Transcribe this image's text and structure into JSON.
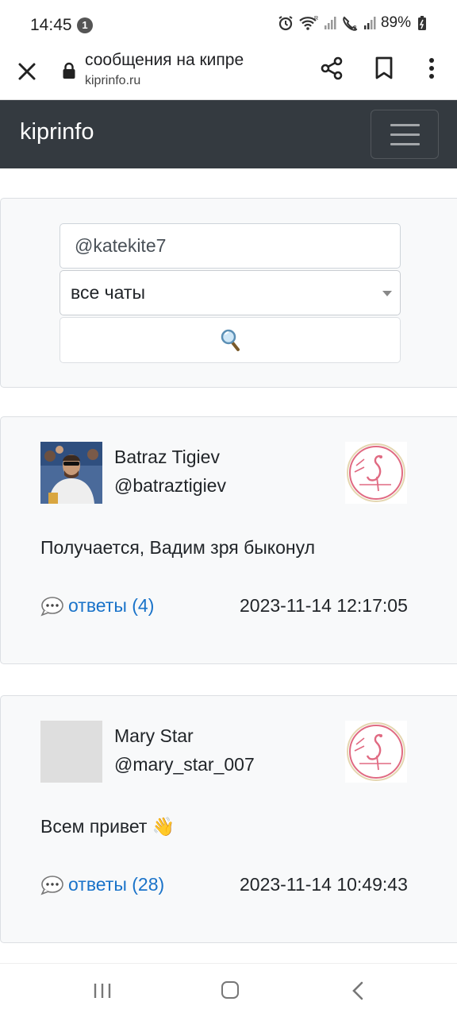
{
  "status_bar": {
    "time": "14:45",
    "notification_count": "1",
    "battery": "89%"
  },
  "browser": {
    "page_title": "сообщения на кипре",
    "domain": "kiprinfo.ru"
  },
  "navbar": {
    "brand": "kiprinfo"
  },
  "search": {
    "username_value": "@katekite7",
    "chat_select_value": "все чаты",
    "button_icon": "magnifier-icon"
  },
  "messages": [
    {
      "name": "Batraz Tigiev",
      "handle": "@batraztigiev",
      "text": "Получается, Вадим зря быконул",
      "replies": "ответы (4)",
      "date": "2023-11-14 12:17:05"
    },
    {
      "name": "Mary Star",
      "handle": "@mary_star_007",
      "text": "Всем привет 👋",
      "replies": "ответы (28)",
      "date": "2023-11-14 10:49:43"
    }
  ],
  "colors": {
    "navbar_bg": "#343a40",
    "link": "#1a73c9",
    "card_bg": "#f8f9fa",
    "logo_pink": "#e0607a"
  }
}
